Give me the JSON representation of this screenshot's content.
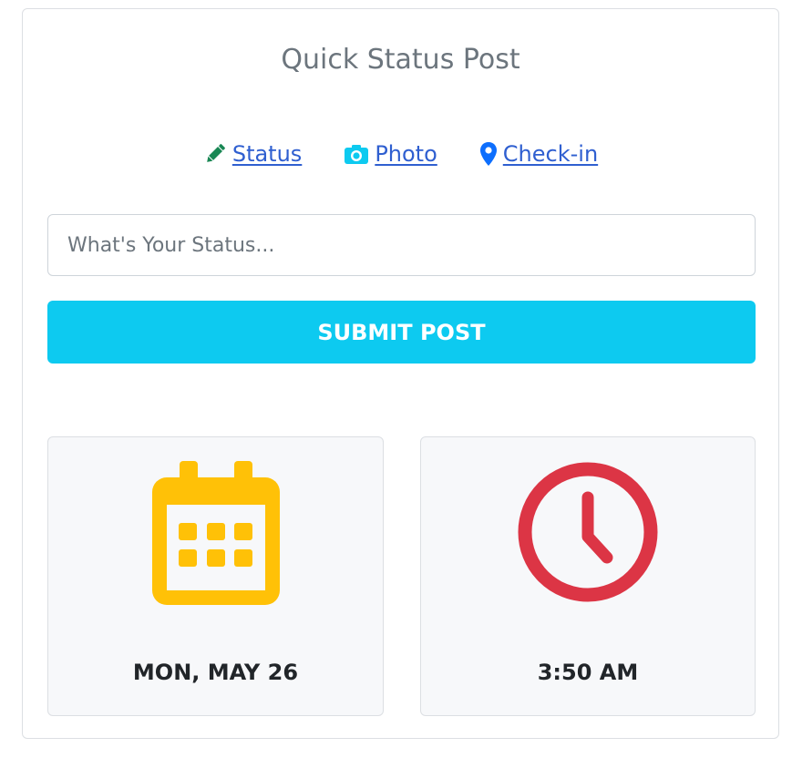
{
  "header": {
    "title": "Quick Status Post"
  },
  "tabs": [
    {
      "label": "Status",
      "icon": "pencil-icon",
      "color": "#198754"
    },
    {
      "label": "Photo",
      "icon": "camera-icon",
      "color": "#0dcaf0"
    },
    {
      "label": "Check-in",
      "icon": "map-marker-icon",
      "color": "#0d6efd"
    }
  ],
  "form": {
    "placeholder": "What's Your Status...",
    "value": "",
    "submit_label": "SUBMIT POST",
    "submit_color": "#0dcaf0"
  },
  "info": {
    "date": {
      "label": "MON, MAY 26",
      "icon": "calendar-icon",
      "color": "#ffc107"
    },
    "time": {
      "label": "3:50 AM",
      "icon": "clock-icon",
      "color": "#dc3545"
    }
  }
}
